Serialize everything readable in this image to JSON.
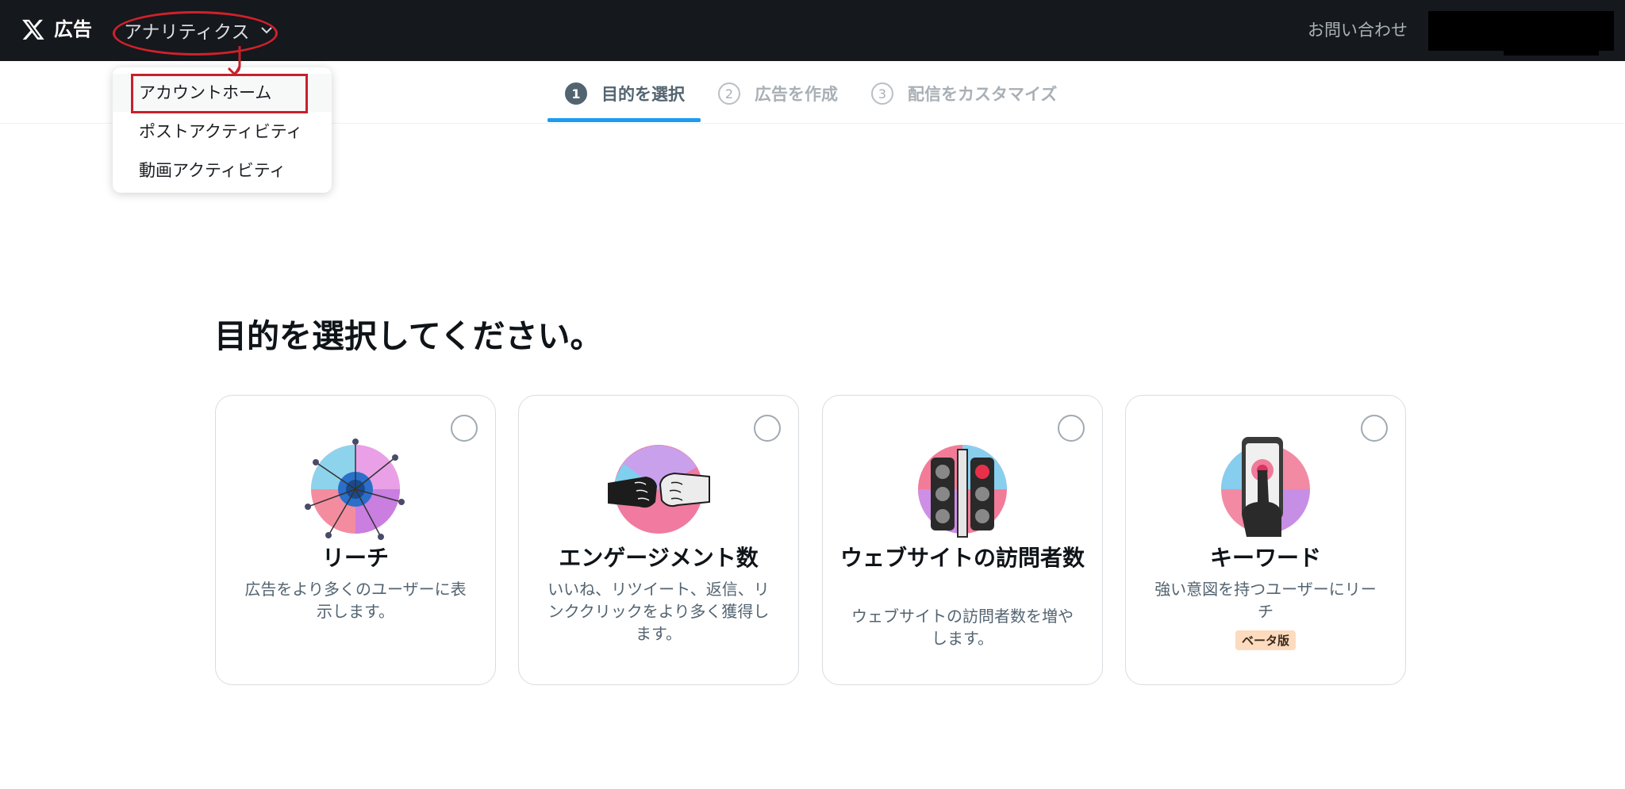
{
  "header": {
    "brand": "広告",
    "analytics_label": "アナリティクス",
    "contact_label": "お問い合わせ"
  },
  "dropdown": {
    "items": [
      {
        "label": "アカウントホーム"
      },
      {
        "label": "ポストアクティビティ"
      },
      {
        "label": "動画アクティビティ"
      }
    ]
  },
  "stepper": {
    "steps": [
      {
        "num": "1",
        "label": "目的を選択"
      },
      {
        "num": "2",
        "label": "広告を作成"
      },
      {
        "num": "3",
        "label": "配信をカスタマイズ"
      }
    ],
    "active_index": 0
  },
  "main": {
    "title": "目的を選択してください。",
    "cards": [
      {
        "title": "リーチ",
        "description": "広告をより多くのユーザーに表示します。",
        "icon": "reach-illustration-icon"
      },
      {
        "title": "エンゲージメント数",
        "description": "いいね、リツイート、返信、リンククリックをより多く獲得します。",
        "icon": "fist-bump-illustration-icon"
      },
      {
        "title": "ウェブサイトの訪問者数",
        "description": "ウェブサイトの訪問者数を増やします。",
        "icon": "traffic-light-illustration-icon"
      },
      {
        "title": "キーワード",
        "description": "強い意図を持つユーザーにリーチ",
        "icon": "phone-touch-illustration-icon",
        "badge": "ベータ版"
      }
    ]
  },
  "colors": {
    "topbar": "#15181c",
    "annotation_red": "#c8202a",
    "accent_blue": "#1d9bf0",
    "badge_bg": "#fddbbe"
  }
}
